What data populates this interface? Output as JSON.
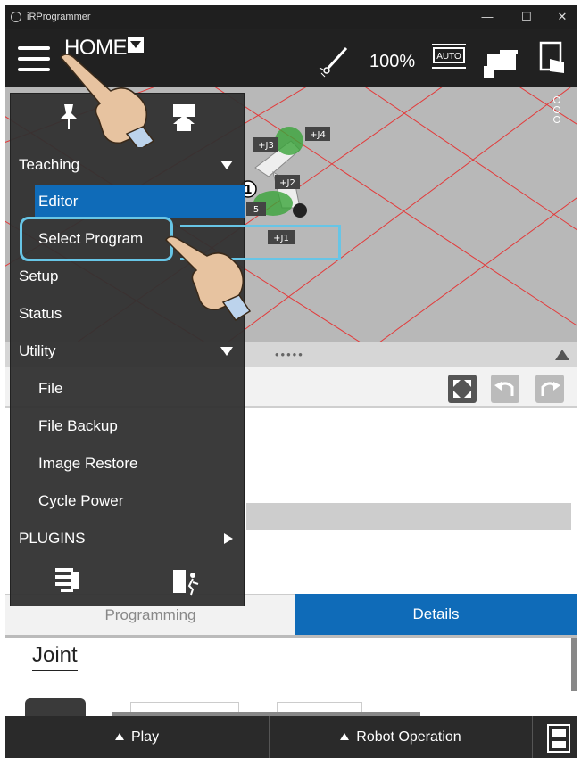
{
  "window": {
    "title": "iRProgrammer",
    "minimize": "—",
    "maximize": "☐",
    "close": "✕"
  },
  "header": {
    "home_label": "HOME",
    "speed": "100%",
    "auto_label": "AUTO",
    "icons": [
      "menu-icon",
      "laser-pointer-icon",
      "auto-mode-icon",
      "robot-teach-icon",
      "touch-screen-icon"
    ]
  },
  "view": {
    "joint_labels": [
      "+J4",
      "+J3",
      "+J2",
      "5",
      "+J1"
    ],
    "callout_number": "1",
    "grid_color": "#e33a3a",
    "floor_color": "#b8b8b8"
  },
  "menu": {
    "items": [
      {
        "label": "Teaching",
        "level": 0,
        "expanded": true
      },
      {
        "label": "Editor",
        "level": 1,
        "selected": true
      },
      {
        "label": "Select Program",
        "level": 1
      },
      {
        "label": "Setup",
        "level": 0
      },
      {
        "label": "Status",
        "level": 0
      },
      {
        "label": "Utility",
        "level": 0,
        "expanded": true
      },
      {
        "label": "File",
        "level": 1
      },
      {
        "label": "File Backup",
        "level": 1
      },
      {
        "label": "Image Restore",
        "level": 1
      },
      {
        "label": "Cycle Power",
        "level": 1
      },
      {
        "label": "PLUGINS",
        "level": 0,
        "submenu": true
      }
    ],
    "icons": [
      "pin-icon",
      "home-menu-icon",
      "settings-list-icon",
      "exit-icon"
    ]
  },
  "tabs": {
    "programming": "Programming",
    "details": "Details",
    "active": "Details"
  },
  "details": {
    "joint_label": "Joint"
  },
  "bottombar": {
    "play": "Play",
    "robot_operation": "Robot Operation"
  },
  "colors": {
    "accent": "#0f6bb8",
    "highlight": "#67c5e6",
    "header_bg": "#212121"
  }
}
